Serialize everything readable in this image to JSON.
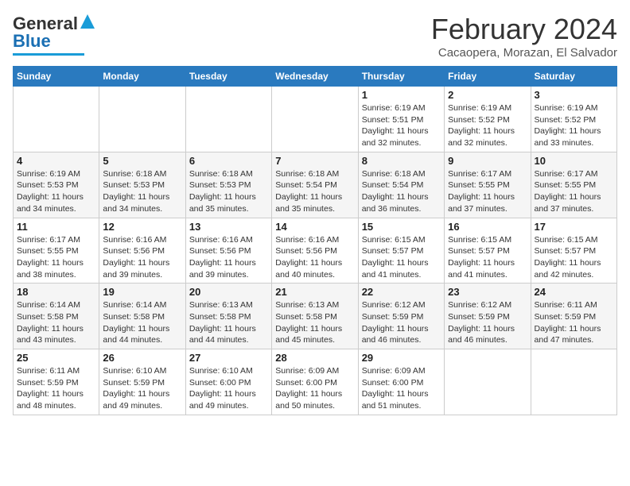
{
  "header": {
    "logo_general": "General",
    "logo_blue": "Blue",
    "title": "February 2024",
    "subtitle": "Cacaopera, Morazan, El Salvador"
  },
  "weekdays": [
    "Sunday",
    "Monday",
    "Tuesday",
    "Wednesday",
    "Thursday",
    "Friday",
    "Saturday"
  ],
  "weeks": [
    [
      {
        "day": "",
        "info": ""
      },
      {
        "day": "",
        "info": ""
      },
      {
        "day": "",
        "info": ""
      },
      {
        "day": "",
        "info": ""
      },
      {
        "day": "1",
        "info": "Sunrise: 6:19 AM\nSunset: 5:51 PM\nDaylight: 11 hours and 32 minutes."
      },
      {
        "day": "2",
        "info": "Sunrise: 6:19 AM\nSunset: 5:52 PM\nDaylight: 11 hours and 32 minutes."
      },
      {
        "day": "3",
        "info": "Sunrise: 6:19 AM\nSunset: 5:52 PM\nDaylight: 11 hours and 33 minutes."
      }
    ],
    [
      {
        "day": "4",
        "info": "Sunrise: 6:19 AM\nSunset: 5:53 PM\nDaylight: 11 hours and 34 minutes."
      },
      {
        "day": "5",
        "info": "Sunrise: 6:18 AM\nSunset: 5:53 PM\nDaylight: 11 hours and 34 minutes."
      },
      {
        "day": "6",
        "info": "Sunrise: 6:18 AM\nSunset: 5:53 PM\nDaylight: 11 hours and 35 minutes."
      },
      {
        "day": "7",
        "info": "Sunrise: 6:18 AM\nSunset: 5:54 PM\nDaylight: 11 hours and 35 minutes."
      },
      {
        "day": "8",
        "info": "Sunrise: 6:18 AM\nSunset: 5:54 PM\nDaylight: 11 hours and 36 minutes."
      },
      {
        "day": "9",
        "info": "Sunrise: 6:17 AM\nSunset: 5:55 PM\nDaylight: 11 hours and 37 minutes."
      },
      {
        "day": "10",
        "info": "Sunrise: 6:17 AM\nSunset: 5:55 PM\nDaylight: 11 hours and 37 minutes."
      }
    ],
    [
      {
        "day": "11",
        "info": "Sunrise: 6:17 AM\nSunset: 5:55 PM\nDaylight: 11 hours and 38 minutes."
      },
      {
        "day": "12",
        "info": "Sunrise: 6:16 AM\nSunset: 5:56 PM\nDaylight: 11 hours and 39 minutes."
      },
      {
        "day": "13",
        "info": "Sunrise: 6:16 AM\nSunset: 5:56 PM\nDaylight: 11 hours and 39 minutes."
      },
      {
        "day": "14",
        "info": "Sunrise: 6:16 AM\nSunset: 5:56 PM\nDaylight: 11 hours and 40 minutes."
      },
      {
        "day": "15",
        "info": "Sunrise: 6:15 AM\nSunset: 5:57 PM\nDaylight: 11 hours and 41 minutes."
      },
      {
        "day": "16",
        "info": "Sunrise: 6:15 AM\nSunset: 5:57 PM\nDaylight: 11 hours and 41 minutes."
      },
      {
        "day": "17",
        "info": "Sunrise: 6:15 AM\nSunset: 5:57 PM\nDaylight: 11 hours and 42 minutes."
      }
    ],
    [
      {
        "day": "18",
        "info": "Sunrise: 6:14 AM\nSunset: 5:58 PM\nDaylight: 11 hours and 43 minutes."
      },
      {
        "day": "19",
        "info": "Sunrise: 6:14 AM\nSunset: 5:58 PM\nDaylight: 11 hours and 44 minutes."
      },
      {
        "day": "20",
        "info": "Sunrise: 6:13 AM\nSunset: 5:58 PM\nDaylight: 11 hours and 44 minutes."
      },
      {
        "day": "21",
        "info": "Sunrise: 6:13 AM\nSunset: 5:58 PM\nDaylight: 11 hours and 45 minutes."
      },
      {
        "day": "22",
        "info": "Sunrise: 6:12 AM\nSunset: 5:59 PM\nDaylight: 11 hours and 46 minutes."
      },
      {
        "day": "23",
        "info": "Sunrise: 6:12 AM\nSunset: 5:59 PM\nDaylight: 11 hours and 46 minutes."
      },
      {
        "day": "24",
        "info": "Sunrise: 6:11 AM\nSunset: 5:59 PM\nDaylight: 11 hours and 47 minutes."
      }
    ],
    [
      {
        "day": "25",
        "info": "Sunrise: 6:11 AM\nSunset: 5:59 PM\nDaylight: 11 hours and 48 minutes."
      },
      {
        "day": "26",
        "info": "Sunrise: 6:10 AM\nSunset: 5:59 PM\nDaylight: 11 hours and 49 minutes."
      },
      {
        "day": "27",
        "info": "Sunrise: 6:10 AM\nSunset: 6:00 PM\nDaylight: 11 hours and 49 minutes."
      },
      {
        "day": "28",
        "info": "Sunrise: 6:09 AM\nSunset: 6:00 PM\nDaylight: 11 hours and 50 minutes."
      },
      {
        "day": "29",
        "info": "Sunrise: 6:09 AM\nSunset: 6:00 PM\nDaylight: 11 hours and 51 minutes."
      },
      {
        "day": "",
        "info": ""
      },
      {
        "day": "",
        "info": ""
      }
    ]
  ]
}
